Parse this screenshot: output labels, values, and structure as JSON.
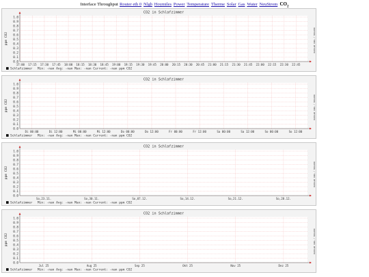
{
  "nav": {
    "prefix": "Interface Throughput",
    "links": [
      "Router eth 0",
      "Nlgb",
      "Hoymiles",
      "Power",
      "Temperature",
      "Therme",
      "Solar",
      "Gas",
      "Water",
      "NeuStrom"
    ],
    "current_main": "CO",
    "current_sub": "2"
  },
  "rrdtool_label": "RRDTOOL / TOBI OETIKER",
  "colors": {
    "panel_bg": "#f3f3f3",
    "plot_bg": "#ffffff",
    "grid": "#f2a8a8",
    "axis": "#555555",
    "series": "#000000"
  },
  "graphs": [
    {
      "title": "CO2 in Schlafzimmer",
      "ylabel": "ppm CO2",
      "yticks": [
        "1.0",
        "0.9",
        "0.8",
        "0.7",
        "0.6",
        "0.5",
        "0.4",
        "0.3",
        "0.2",
        "0.1",
        "0.0"
      ],
      "xticks": [
        "17:00",
        "17:15",
        "17:30",
        "17:45",
        "18:00",
        "18:15",
        "18:30",
        "18:45",
        "19:00",
        "19:15",
        "19:30",
        "19:45",
        "20:00",
        "20:15",
        "20:30",
        "20:45",
        "21:00",
        "21:15",
        "21:30",
        "21:45",
        "22:00",
        "22:15",
        "22:30",
        "22:45"
      ],
      "legend": {
        "name": "Schlafzimmer",
        "stats": "Min:   -nan     Avg:   -nan     Max:    -nan     Current:  -nan ppm CO2"
      }
    },
    {
      "title": "CO2 in Schlafzimmer",
      "ylabel": "ppm CO2",
      "yticks": [
        "1.0",
        "0.9",
        "0.8",
        "0.7",
        "0.6",
        "0.5",
        "0.4",
        "0.3",
        "0.2",
        "0.1",
        "0.0"
      ],
      "xticks": [
        "Di 00:00",
        "Di 12:00",
        "Mi 00:00",
        "Mi 12:00",
        "Do 00:00",
        "Do 12:00",
        "Fr 00:00",
        "Fr 12:00",
        "Sa 00:00",
        "Sa 12:00",
        "So 00:00",
        "So 12:00"
      ],
      "legend": {
        "name": "Schlafzimmer",
        "stats": "Min:   -nan     Avg:   -nan     Max:    -nan     Current:  -nan ppm CO2"
      }
    },
    {
      "title": "CO2 in Schlafzimmer",
      "ylabel": "ppm CO2",
      "yticks": [
        "1.0",
        "0.9",
        "0.8",
        "0.7",
        "0.6",
        "0.5",
        "0.4",
        "0.3",
        "0.2",
        "0.1",
        "0.0"
      ],
      "xticks": [
        "So,23.11.",
        "So,30.11.",
        "So,07.12.",
        "So,14.12.",
        "So,21.12.",
        "So,28.12."
      ],
      "legend": {
        "name": "Schlafzimmer",
        "stats": "Min:   -nan     Avg:   -nan     Max:    -nan     Current:  -nan ppm CO2"
      }
    },
    {
      "title": "CO2 in Schlafzimmer",
      "ylabel": "ppm CO2",
      "yticks": [
        "1.0",
        "0.9",
        "0.8",
        "0.7",
        "0.6",
        "0.5",
        "0.4",
        "0.3",
        "0.2",
        "0.1",
        "0.0"
      ],
      "xticks": [
        "Jul 25",
        "Aug 25",
        "Sep 25",
        "Okt 25",
        "Nov 25",
        "Dez 25"
      ],
      "legend": {
        "name": "Schlafzimmer",
        "stats": "Min:   -nan     Avg:   -nan     Max:    -nan     Current:  -nan ppm CO2"
      }
    }
  ]
}
